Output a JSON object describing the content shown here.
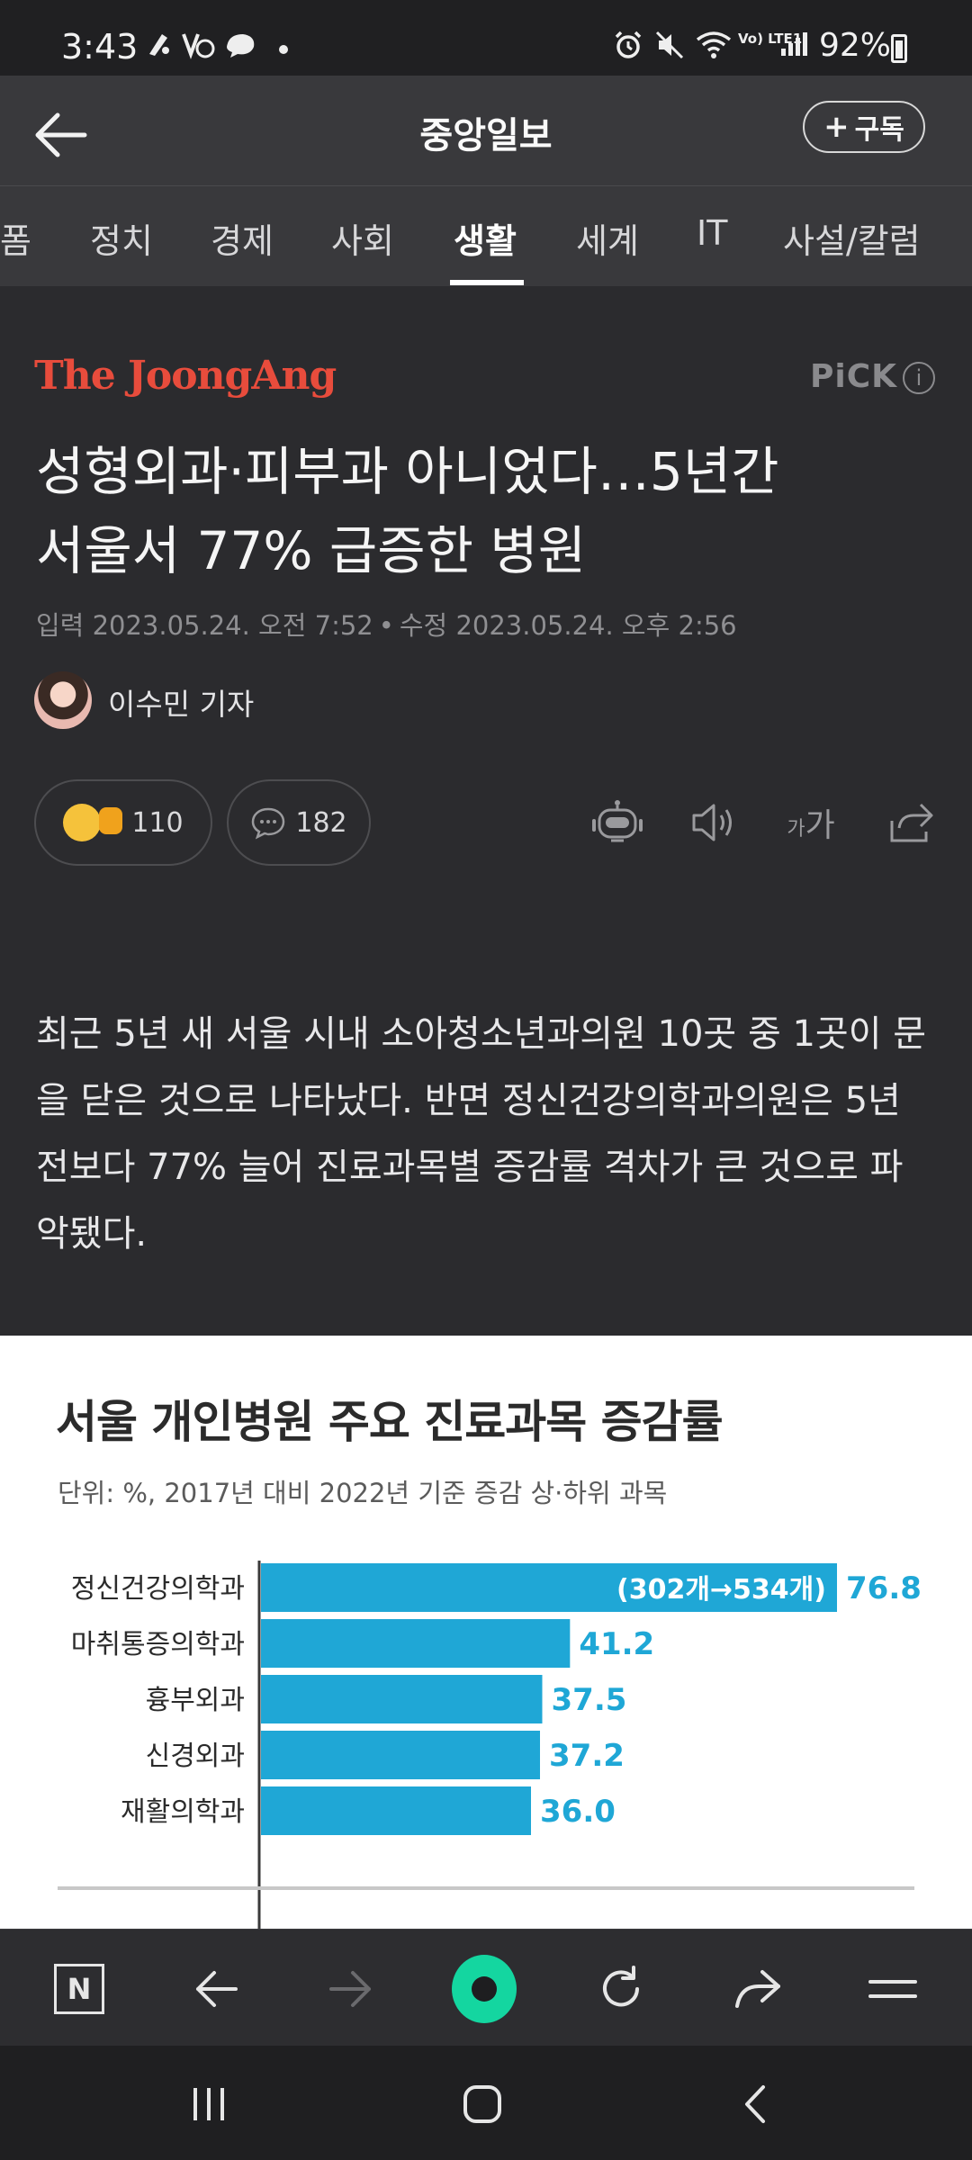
{
  "status_bar": {
    "time": "3:43",
    "battery": "92%",
    "icons": [
      "notification-app-icon",
      "notification-app-icon",
      "notification-app-icon",
      "dot-icon",
      "alarm-icon",
      "mute-icon",
      "wifi-icon",
      "volte-icon",
      "signal-icon",
      "battery-icon"
    ],
    "network_label": "Vo) LTE1"
  },
  "header": {
    "title": "중앙일보",
    "subscribe_label": "구독",
    "subscribe_plus": "+"
  },
  "tabs": [
    {
      "label": "폼"
    },
    {
      "label": "정치"
    },
    {
      "label": "경제"
    },
    {
      "label": "사회"
    },
    {
      "label": "생활",
      "active": true
    },
    {
      "label": "세계"
    },
    {
      "label": "IT"
    },
    {
      "label": "사설/칼럼"
    }
  ],
  "article": {
    "brand": "The JoongAng",
    "pick": "PiCK",
    "pick_info": "i",
    "headline_line1": "성형외과·피부과 아니었다…5년간",
    "headline_line2": "서울서 77% 급증한 병원",
    "published": "입력 2023.05.24. 오전 7:52",
    "date_separator": "•",
    "modified": "수정 2023.05.24. 오후 2:56",
    "author": "이수민 기자",
    "reactions_count": "110",
    "comments_count": "182",
    "font_size_label_small": "가",
    "font_size_label_large": "가",
    "lede": "최근 5년 새 서울 시내 소아청소년과의원 10곳 중 1곳이 문을 닫은 것으로 나타났다. 반면 정신건강의학과의원은 5년 전보다 77% 늘어 진료과목별 증감률 격차가 큰 것으로 파악됐다."
  },
  "chart_data": {
    "type": "bar",
    "orientation": "horizontal",
    "title": "서울 개인병원 주요 진료과목 증감률",
    "subtitle": "단위: %, 2017년 대비 2022년 기준 증감 상·하위 과목",
    "categories": [
      "정신건강의학과",
      "마취통증의학과",
      "흉부외과",
      "신경외과",
      "재활의학과"
    ],
    "values": [
      76.8,
      41.2,
      37.5,
      37.2,
      36.0
    ],
    "value_labels": [
      "76.8",
      "41.2",
      "37.5",
      "37.2",
      "36.0"
    ],
    "annotation": "(302개→534개)",
    "bar_color": "#1fa7d6",
    "label_color": "#1fa7d6"
  },
  "browser_toolbar": {
    "icons": [
      "naver-n-icon",
      "back-arrow-icon",
      "forward-arrow-icon",
      "home-green-icon",
      "reload-icon",
      "share-arrow-icon",
      "menu-icon"
    ],
    "n_label": "N"
  },
  "system_nav": {
    "icons": [
      "recent-apps-icon",
      "home-icon",
      "back-icon"
    ]
  }
}
